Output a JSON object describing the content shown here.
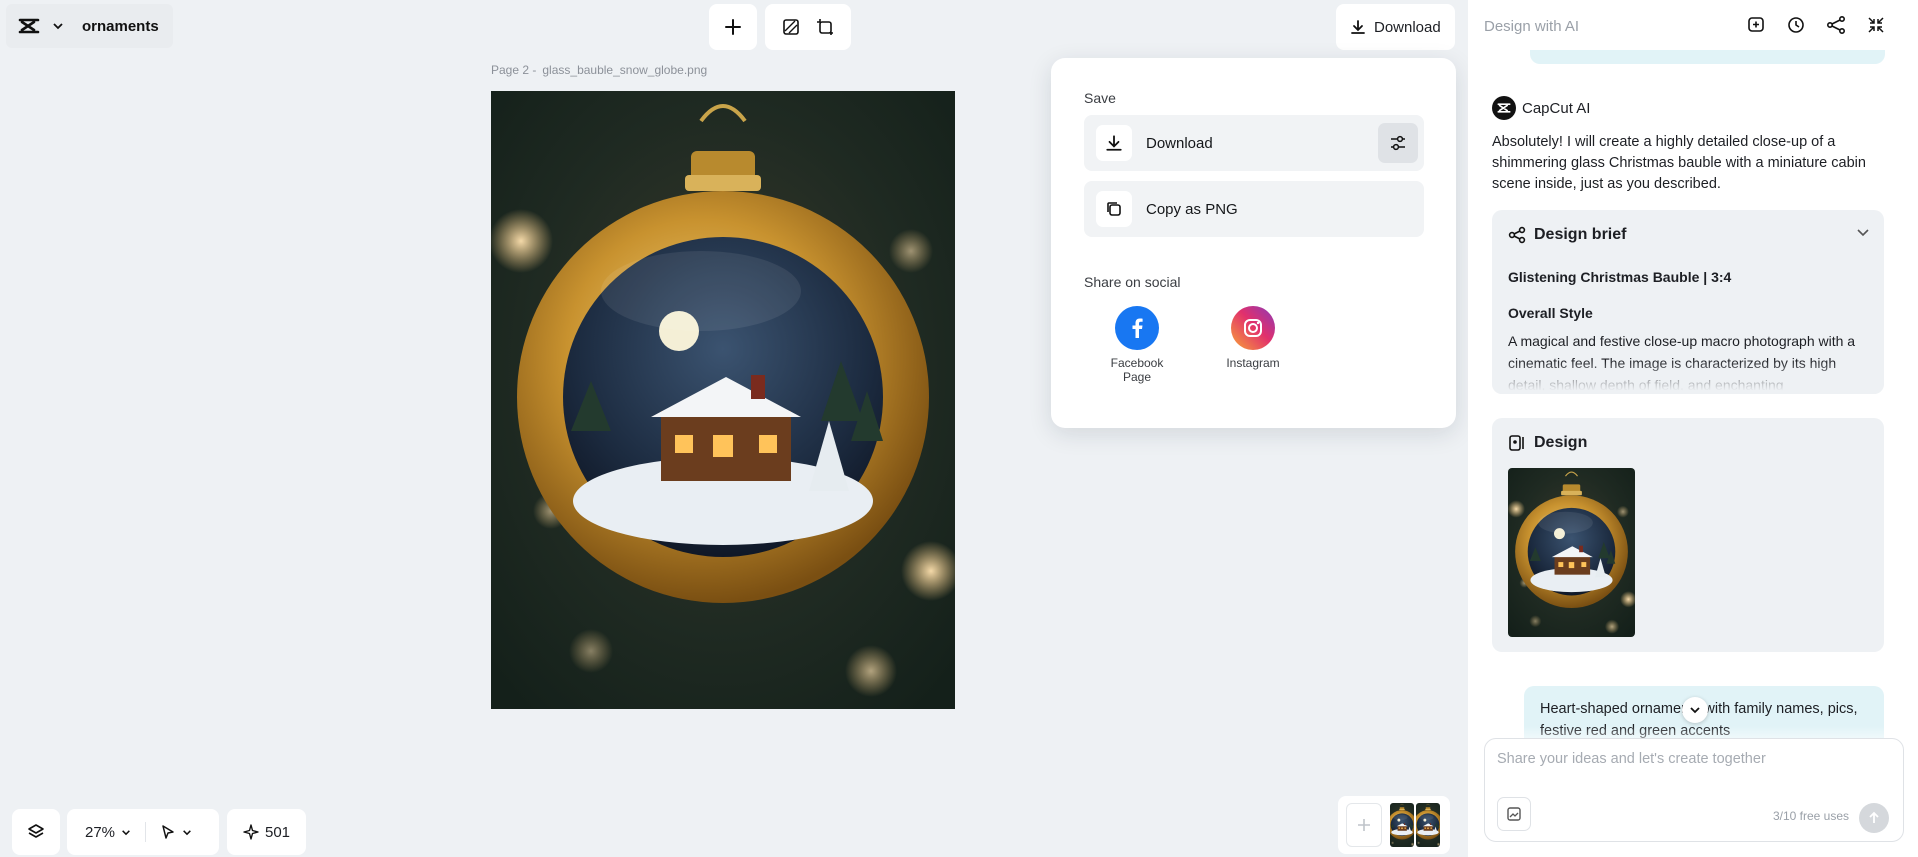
{
  "header": {
    "project_name": "ornaments",
    "download_label": "Download"
  },
  "canvas": {
    "page_label": "Page 2 -",
    "file_name": "glass_bauble_snow_globe.png"
  },
  "save_menu": {
    "section_save": "Save",
    "download_label": "Download",
    "copy_label": "Copy as PNG",
    "section_share": "Share on social",
    "social": [
      {
        "label": "Facebook Page",
        "color": "#1877f2"
      },
      {
        "label": "Instagram",
        "color": "#e1306c"
      }
    ]
  },
  "panel": {
    "title": "Design with AI",
    "ai_name": "CapCut AI",
    "ai_message": "Absolutely! I will create a highly detailed close-up of a shimmering glass Christmas bauble with a miniature cabin scene inside, just as you described.",
    "brief": {
      "title": "Design brief",
      "subtitle": "Glistening Christmas Bauble | 3:4",
      "style_heading": "Overall Style",
      "style_text": "A magical and festive close-up macro photograph with a cinematic feel. The image is characterized by its high detail, shallow depth of field, and enchanting"
    },
    "design_title": "Design",
    "user_message": "Heart-shaped ornaments with family names, pics, festive red and green accents",
    "composer_placeholder": "Share your ideas and let's create together",
    "free_uses": "3/10 free uses"
  },
  "bottom": {
    "zoom": "27%",
    "credits": "501"
  },
  "colors": {
    "accent_bubble": "#e1f3f7",
    "panel_bg": "#ffffff",
    "canvas_bg": "#eef1f4"
  }
}
